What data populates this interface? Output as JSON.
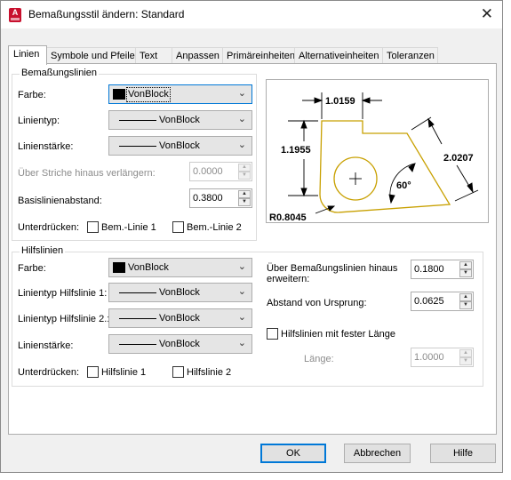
{
  "window": {
    "title": "Bemaßungsstil ändern: Standard",
    "app_icon_letter": "A"
  },
  "tabs": [
    "Linien",
    "Symbole und Pfeile",
    "Text",
    "Anpassen",
    "Primäreinheiten",
    "Alternativeinheiten",
    "Toleranzen"
  ],
  "bemasslinien": {
    "title": "Bemaßungslinien",
    "farbe_label": "Farbe:",
    "farbe_value": "VonBlock",
    "linientyp_label": "Linientyp:",
    "linientyp_value": "VonBlock",
    "linienstaerke_label": "Linienstärke:",
    "linienstaerke_value": "VonBlock",
    "verlaengern_label": "Über Striche hinaus verlängern:",
    "verlaengern_value": "0.0000",
    "basis_label": "Basislinienabstand:",
    "basis_value": "0.3800",
    "unterdruecken_label": "Unterdrücken:",
    "cb1_label": "Bem.-Linie 1",
    "cb2_label": "Bem.-Linie 2"
  },
  "preview": {
    "dim_top": "1.0159",
    "dim_left": "1.1955",
    "dim_right": "2.0207",
    "angle": "60°",
    "radius": "R0.8045",
    "line_color": "#c8a000"
  },
  "hilfslinien": {
    "title": "Hilfslinien",
    "farbe_label": "Farbe:",
    "farbe_value": "VonBlock",
    "lt1_label": "Linientyp Hilfslinie 1:",
    "lt1_value": "VonBlock",
    "lt2_label": "Linientyp Hilfslinie 2.:",
    "lt2_value": "VonBlock",
    "staerke_label": "Linienstärke:",
    "staerke_value": "VonBlock",
    "unterdruecken_label": "Unterdrücken:",
    "cb1_label": "Hilfslinie 1",
    "cb2_label": "Hilfslinie 2",
    "erweitern_label_1": "Über Bemaßungslinien hinaus",
    "erweitern_label_2": "erweitern:",
    "erweitern_value": "0.1800",
    "abstand_label": "Abstand von Ursprung:",
    "abstand_value": "0.0625",
    "feste_label": "Hilfslinien mit fester Länge",
    "laenge_label": "Länge:",
    "laenge_value": "1.0000"
  },
  "buttons": {
    "ok": "OK",
    "cancel": "Abbrechen",
    "help": "Hilfe"
  }
}
